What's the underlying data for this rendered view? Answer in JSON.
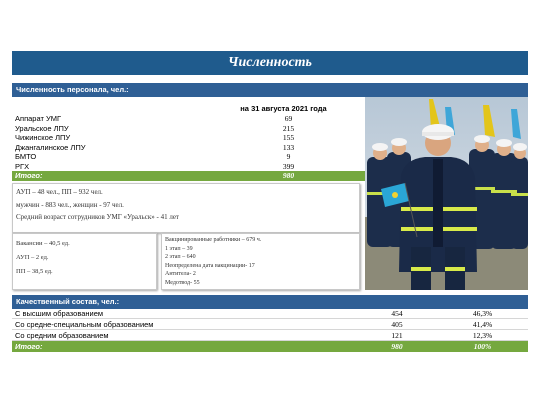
{
  "title": "Численность",
  "headcount": {
    "section_title": "Численность персонала, чел.:",
    "column_header": "на 31 августа 2021 года",
    "rows": [
      {
        "name": "Аппарат УМГ",
        "value": "69"
      },
      {
        "name": "Уральское ЛПУ",
        "value": "215"
      },
      {
        "name": "Чижинское ЛПУ",
        "value": "155"
      },
      {
        "name": "Джангалинское ЛПУ",
        "value": "133"
      },
      {
        "name": "БМТО",
        "value": "9"
      },
      {
        "name": "РГХ",
        "value": "399"
      }
    ],
    "total": {
      "name": "Итого:",
      "value": "980"
    }
  },
  "summary": {
    "line1": "АУП – 48 чел., ПП – 932 чел.",
    "line2": "мужчин - 883 чел., женщин - 97 чел.",
    "line3": "Средний возраст сотрудников УМГ «Уральск» - 41 лет"
  },
  "vacancies": {
    "line1": "Вакансии – 40,5 ед.",
    "line2": "АУП – 2 ед.",
    "line3": "ПП – 38,5 ед."
  },
  "vaccination": {
    "line1": "Вакцинированные работники – 679 ч.",
    "line2": "1 этап – 39",
    "line3": "2 этап – 640",
    "line4": "Неопределена дата вакцинации- 17",
    "line5": "Антитела- 2",
    "line6": "Медотвод- 55"
  },
  "qualification": {
    "section_title": "Качественный состав, чел.:",
    "rows": [
      {
        "name": "С высшим образованием",
        "count": "454",
        "pct": "46,3%"
      },
      {
        "name": "Со средне-специальным образованием",
        "count": "405",
        "pct": "41,4%"
      },
      {
        "name": "Со средним образованием",
        "count": "121",
        "pct": "12,3%"
      }
    ],
    "total": {
      "name": "Итого:",
      "count": "980",
      "pct": "100%"
    }
  },
  "colors": {
    "title_bar": "#1f5b8d",
    "section_bar": "#2f5f95",
    "total_row": "#75a83f"
  },
  "photo": {
    "icon": "workers-photo"
  }
}
